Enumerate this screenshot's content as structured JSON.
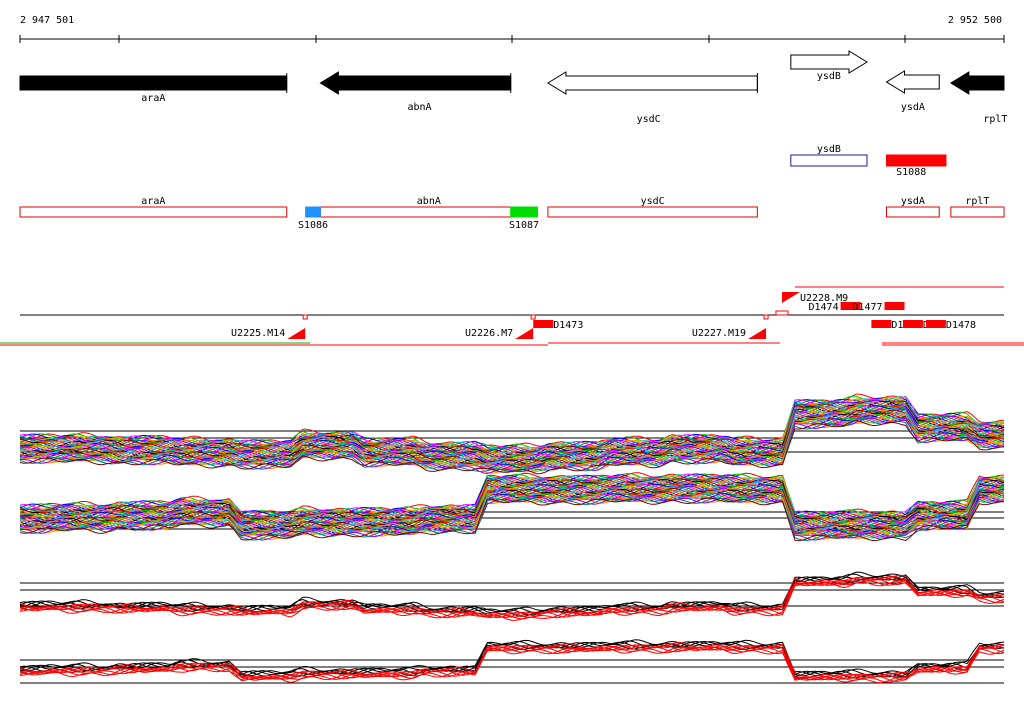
{
  "ruler": {
    "start_label": "2 947 501",
    "end_label": "2 952 500",
    "start": 2947501,
    "end": 2952500
  },
  "genes": [
    {
      "name": "araA",
      "start": 2947501,
      "end": 2948856,
      "strand": "-",
      "filled": true
    },
    {
      "name": "abnA",
      "start": 2949027,
      "end": 2949994,
      "strand": "-",
      "filled": true
    },
    {
      "name": "ysdC",
      "start": 2950183,
      "end": 2951247,
      "strand": "-",
      "filled": false
    },
    {
      "name": "ysdB",
      "start": 2951417,
      "end": 2951804,
      "strand": "+",
      "filled": false
    },
    {
      "name": "ysdA",
      "start": 2951903,
      "end": 2952171,
      "strand": "-",
      "filled": false
    },
    {
      "name": "rplT",
      "start": 2952230,
      "end": 2952500,
      "strand": "-",
      "filled": true
    }
  ],
  "annotations_row1": [
    {
      "name": "ysdB",
      "start": 2951417,
      "end": 2951804,
      "color": "#1a1aa0",
      "fill": "none"
    },
    {
      "name": "S1088",
      "start": 2951903,
      "end": 2952205,
      "color": "#ff0000",
      "fill": "#ff0000"
    }
  ],
  "annotations_row2": [
    {
      "name": "araA",
      "start": 2947501,
      "end": 2948856
    },
    {
      "name": "abnA",
      "start": 2949027,
      "end": 2950129
    },
    {
      "name": "ysdC",
      "start": 2950183,
      "end": 2951247
    },
    {
      "name": "ysdA",
      "start": 2951903,
      "end": 2952171
    },
    {
      "name": "rplT",
      "start": 2952230,
      "end": 2952500
    }
  ],
  "markers": [
    {
      "name": "S1086",
      "start": 2948952,
      "end": 2949027,
      "color": "#1e90ff"
    },
    {
      "name": "S1087",
      "start": 2949994,
      "end": 2950129,
      "color": "#00dd00"
    }
  ],
  "utr_labels": [
    {
      "name": "U2225.M14",
      "pos": 2948950,
      "side": "below"
    },
    {
      "name": "U2226.M7",
      "pos": 2950108,
      "side": "below"
    },
    {
      "name": "U2227.M19",
      "pos": 2951291,
      "side": "below"
    },
    {
      "name": "U2228.M9",
      "pos": 2951372,
      "side": "above"
    }
  ],
  "d_labels": [
    {
      "name": "D1473",
      "pos": 2950210,
      "side": "below"
    },
    {
      "name": "D1474",
      "pos": 2951670,
      "side": "above"
    },
    {
      "name": "D1477",
      "pos": 2951893,
      "side": "above"
    },
    {
      "name": "D14",
      "pos": 2951928,
      "side": "below"
    },
    {
      "name": "D1",
      "pos": 2952088,
      "side": "below"
    },
    {
      "name": "D1478",
      "pos": 2952205,
      "side": "below"
    }
  ],
  "tracks": {
    "series_count": 40,
    "profile_a_levels": [
      0.3,
      0.3,
      0.28,
      0.25,
      0.22,
      0.35,
      0.25,
      0.2,
      0.15,
      0.2,
      0.25,
      0.3,
      0.25,
      0.8,
      0.85,
      0.6,
      0.5
    ],
    "profile_b_levels": [
      0.4,
      0.42,
      0.45,
      0.5,
      0.3,
      0.35,
      0.35,
      0.4,
      0.85,
      0.85,
      0.86,
      0.87,
      0.85,
      0.3,
      0.3,
      0.45,
      0.85
    ],
    "colors": [
      "#ff0000",
      "#00c000",
      "#0000ff",
      "#ff00ff",
      "#00c0c0",
      "#c0c000",
      "#ff8000",
      "#8000ff",
      "#008080",
      "#800000",
      "#808000",
      "#000000",
      "#ff6080",
      "#40a0ff",
      "#a0a000"
    ]
  }
}
